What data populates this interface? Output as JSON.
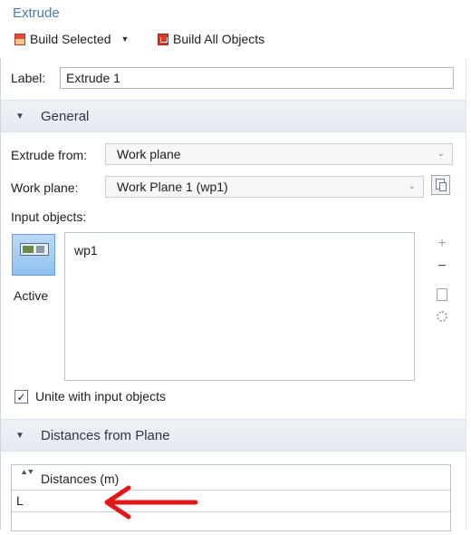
{
  "window": {
    "title": "Extrude"
  },
  "toolbar": {
    "build_selected_label": "Build Selected",
    "build_selected_caret": "▼",
    "build_all_label": "Build All Objects"
  },
  "label_field": {
    "label": "Label:",
    "value": "Extrude 1"
  },
  "sections": {
    "general": {
      "title": "General",
      "extrude_from": {
        "label": "Extrude from:",
        "value": "Work plane"
      },
      "work_plane": {
        "label": "Work plane:",
        "value": "Work Plane 1 (wp1)"
      },
      "input_objects": {
        "label": "Input objects:",
        "active_label": "Active",
        "items": [
          "wp1"
        ]
      },
      "unite": {
        "label": "Unite with input objects",
        "checked": true
      }
    },
    "distances": {
      "title": "Distances from Plane",
      "table": {
        "header": "Distances (m)",
        "rows": [
          "L"
        ]
      }
    }
  },
  "icons": {
    "section_collapse": "▼",
    "add": "+",
    "remove": "−",
    "dropdown": "⌄"
  },
  "colors": {
    "title": "#4a7ab4",
    "section_bg": "#e8edf3",
    "active_button": "#9fcbf0",
    "arrow": "#e01818"
  }
}
